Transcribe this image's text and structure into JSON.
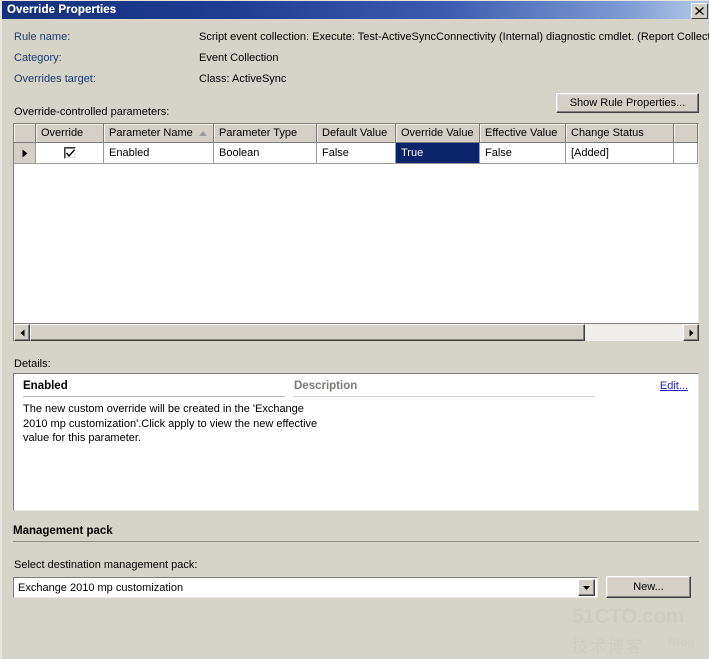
{
  "window": {
    "title": "Override Properties",
    "close_icon": "close-icon"
  },
  "header": {
    "rule_name_label": "Rule name:",
    "rule_name_value": "Script event collection: Execute: Test-ActiveSyncConnectivity (Internal) diagnostic cmdlet. (Report Collectio",
    "category_label": "Category:",
    "category_value": "Event Collection",
    "overrides_target_label": "Overrides target:",
    "overrides_target_value": "Class: ActiveSync",
    "show_rule_properties_button": "Show Rule Properties..."
  },
  "parameters": {
    "section_label": "Override-controlled parameters:",
    "columns": [
      "Override",
      "Parameter Name",
      "Parameter Type",
      "Default Value",
      "Override Value",
      "Effective Value",
      "Change Status"
    ],
    "sorted_column": "Parameter Name",
    "sort_direction": "ascending",
    "rows": [
      {
        "selected": true,
        "override_checked": true,
        "parameter_name": "Enabled",
        "parameter_type": "Boolean",
        "default_value": "False",
        "override_value": "True",
        "effective_value": "False",
        "change_status": "[Added]"
      }
    ],
    "selected_cell": "override_value",
    "selection_color": "#0a246a",
    "scrollbar": {
      "left_arrow": "scroll-left-icon",
      "right_arrow": "scroll-right-icon",
      "thumb_percent": 85
    }
  },
  "details": {
    "section_label": "Details:",
    "title": "Enabled",
    "description_header": "Description",
    "edit_link": "Edit...",
    "body": "The new custom override will be created in the 'Exchange 2010 mp customization'.Click apply to view the new effective value for this parameter.",
    "link_color": "#1c1ccc"
  },
  "management_pack": {
    "heading": "Management pack",
    "select_label": "Select destination management pack:",
    "selected_value": "Exchange 2010 mp customization",
    "dropdown_icon": "chevron-down-icon",
    "new_button": "New..."
  },
  "watermark": {
    "line1": "51CTO.com",
    "line2": "技术博客",
    "line3": "Blog"
  }
}
